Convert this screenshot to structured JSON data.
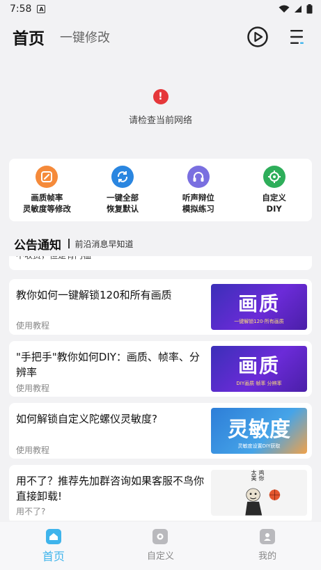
{
  "status_bar": {
    "time": "7:58",
    "badge": "A"
  },
  "header": {
    "title": "首页",
    "subtitle": "一键修改"
  },
  "banner": {
    "error_symbol": "!",
    "error_text": "请检查当前网络"
  },
  "quick_actions": [
    {
      "label": "画质帧率\n灵敏度等修改",
      "icon": "edit-icon",
      "color": "#f58a3a"
    },
    {
      "label": "一键全部\n恢复默认",
      "icon": "refresh-icon",
      "color": "#2a86e0"
    },
    {
      "label": "听声辩位\n模拟练习",
      "icon": "headset-icon",
      "color": "#7a6fe0"
    },
    {
      "label": "自定义\nDIY",
      "icon": "target-icon",
      "color": "#2eae5a"
    }
  ],
  "notice": {
    "title": "公告通知",
    "subtitle": "前沿消息早知道"
  },
  "feed": [
    {
      "title": "不收费，但是有门槛",
      "tag": ""
    },
    {
      "title": "教你如何一键解锁120和所有画质",
      "tag": "使用教程",
      "thumb_big": "画质",
      "thumb_small": "一键解锁120·所有画质"
    },
    {
      "title": "\"手把手\"教你如何DIY：画质、帧率、分辨率",
      "tag": "使用教程",
      "thumb_big": "画质",
      "thumb_small": "DIY画质 帧率 分辨率"
    },
    {
      "title": "如何解锁自定义陀螺仪灵敏度?",
      "tag": "使用教程",
      "thumb_big": "灵敏度",
      "thumb_small": "灵敏度设置DIY获取"
    },
    {
      "title": "用不了？推荐先加群咨询如果客服不鸟你直接卸载!",
      "tag": "用不了?",
      "thumb_text": "鸡你太美"
    }
  ],
  "tabs": [
    {
      "label": "首页",
      "icon": "home-icon",
      "active": true
    },
    {
      "label": "自定义",
      "icon": "customize-icon",
      "active": false
    },
    {
      "label": "我的",
      "icon": "profile-icon",
      "active": false
    }
  ],
  "colors": {
    "accent": "#3fb4ec",
    "error": "#e5373a"
  }
}
